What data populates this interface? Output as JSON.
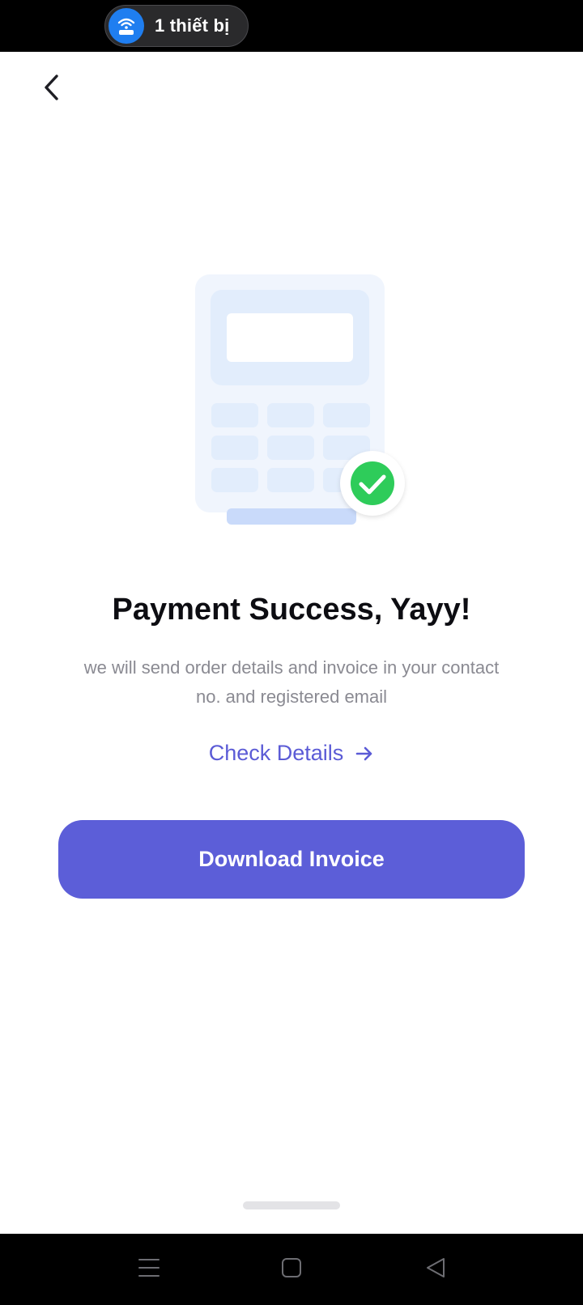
{
  "status_bar": {
    "hotspot_label": "1 thiết bị",
    "hotspot_icon": "wifi-router-icon"
  },
  "header": {
    "back_icon": "chevron-left-icon"
  },
  "illustration": {
    "name": "calculator-with-checkmark",
    "check_icon": "check-circle-icon"
  },
  "content": {
    "title": "Payment Success, Yayy!",
    "subtitle": "we will send order details and invoice in your contact no. and registered email",
    "check_details_label": "Check Details",
    "check_details_icon": "arrow-right-icon"
  },
  "actions": {
    "download_label": "Download Invoice"
  },
  "nav_bar": {
    "menu_icon": "menu-icon",
    "home_icon": "home-square-icon",
    "back_icon": "back-triangle-icon"
  },
  "colors": {
    "accent": "#5c5ed8",
    "link": "#5b5bd6",
    "success": "#2ecc5a",
    "illustration_light": "#f0f5fd",
    "illustration_mid": "#e2edfc",
    "illustration_bar": "#c9dafa"
  }
}
